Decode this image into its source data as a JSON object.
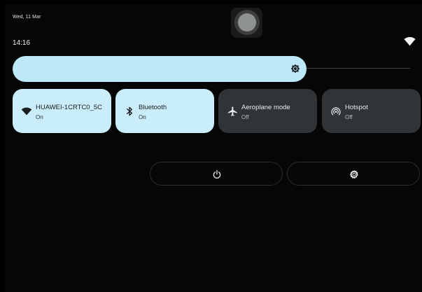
{
  "status": {
    "date": "Wed, 11 Mar",
    "time": "14:16",
    "wifi_icon": "wifi-icon"
  },
  "brightness": {
    "level": 0.74,
    "icon": "brightness-icon"
  },
  "tiles": [
    {
      "label": "HUAWEI-1CRTC0_5C",
      "state": "On",
      "icon": "wifi-icon",
      "active": true
    },
    {
      "label": "Bluetooth",
      "state": "On",
      "icon": "bluetooth-icon",
      "active": true
    },
    {
      "label": "Aeroplane mode",
      "state": "Off",
      "icon": "airplane-icon",
      "active": false
    },
    {
      "label": "Hotspot",
      "state": "Off",
      "icon": "hotspot-icon",
      "active": false
    }
  ],
  "footer": {
    "power_icon": "power-icon",
    "settings_icon": "settings-icon"
  },
  "colors": {
    "tile_on": "#c9edfa",
    "tile_off": "#303437",
    "brightness": "#bde8f7",
    "background": "#060607"
  }
}
